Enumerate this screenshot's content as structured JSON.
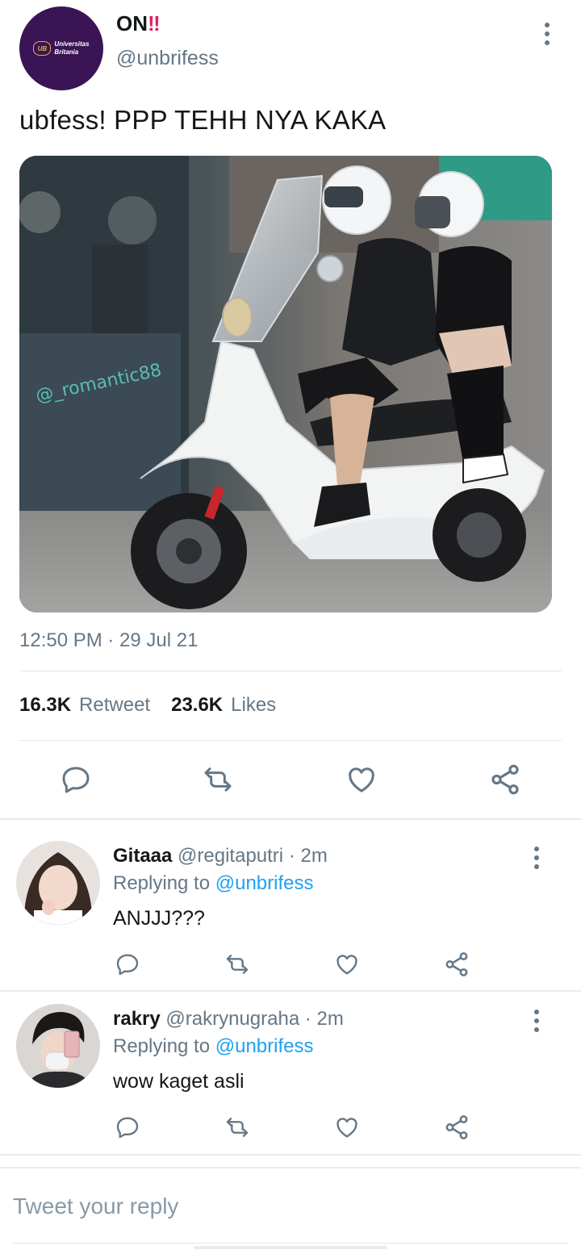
{
  "tweet": {
    "author_name": "ON",
    "author_name_emoji": "‼",
    "author_handle": "@unbrifess",
    "avatar_logo_mark": "UB",
    "avatar_logo_line1": "Universitas",
    "avatar_logo_line2": "Britania",
    "text": "ubfess! PPP TEHH NYA KAKA",
    "photo_watermark": "@_romantic88",
    "timestamp": "12:50 PM · 29 Jul 21",
    "retweet_count": "16.3K",
    "retweet_label": "Retweet",
    "likes_count": "23.6K",
    "likes_label": "Likes"
  },
  "replies": [
    {
      "name": "Gitaaa",
      "handle": "@regitaputri",
      "time": "· 2m",
      "replying_prefix": "Replying to",
      "replying_to": "@unbrifess",
      "text": "ANJJJ???"
    },
    {
      "name": "rakry",
      "handle": "@rakrynugraha",
      "time": "· 2m",
      "replying_prefix": "Replying to",
      "replying_to": "@unbrifess",
      "text": "wow kaget asli"
    }
  ],
  "composer": {
    "placeholder": "Tweet your reply"
  },
  "icons": {
    "reply": "reply-icon",
    "retweet": "retweet-icon",
    "like": "heart-icon",
    "share": "share-icon",
    "more": "more-vertical-icon"
  },
  "colors": {
    "icon_grey": "#657786",
    "link_blue": "#1da1f2",
    "avatar_purple": "#3a1454",
    "divider": "#e1e8ed"
  }
}
